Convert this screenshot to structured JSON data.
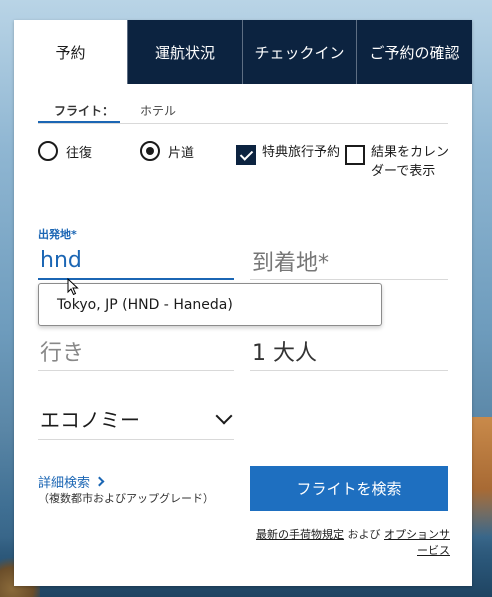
{
  "tabs": [
    {
      "label": "予約",
      "active": true
    },
    {
      "label": "運航状況",
      "active": false
    },
    {
      "label": "チェックイン",
      "active": false
    },
    {
      "label": "ご予約の確認",
      "active": false
    }
  ],
  "subtabs": {
    "flight": "フライト：",
    "hotel": "ホテル"
  },
  "trip_type": {
    "round_trip": "往復",
    "one_way": "片道",
    "selected": "one_way"
  },
  "options": {
    "award_travel": {
      "label": "特典旅行予約",
      "checked": true
    },
    "calendar": {
      "label": "結果をカレンダーで表示",
      "checked": false
    }
  },
  "origin": {
    "label": "出発地*",
    "value": "hnd"
  },
  "destination": {
    "placeholder": "到着地*"
  },
  "autocomplete": {
    "suggestion": "Tokyo, JP (HND - Haneda)"
  },
  "date": {
    "placeholder": "行き"
  },
  "passengers": {
    "value": "1 大人"
  },
  "cabin": {
    "value": "エコノミー"
  },
  "advanced": {
    "link": "詳細検索",
    "sub": "（複数都市およびアップグレード）"
  },
  "search_button": "フライトを検索",
  "footnote": {
    "link1": "最新の手荷物規定",
    "and": "および",
    "link2": "オプションサービス"
  },
  "colors": {
    "brand_navy": "#0c2340",
    "primary_blue": "#1e6fc0",
    "link_blue": "#1b66b4"
  }
}
